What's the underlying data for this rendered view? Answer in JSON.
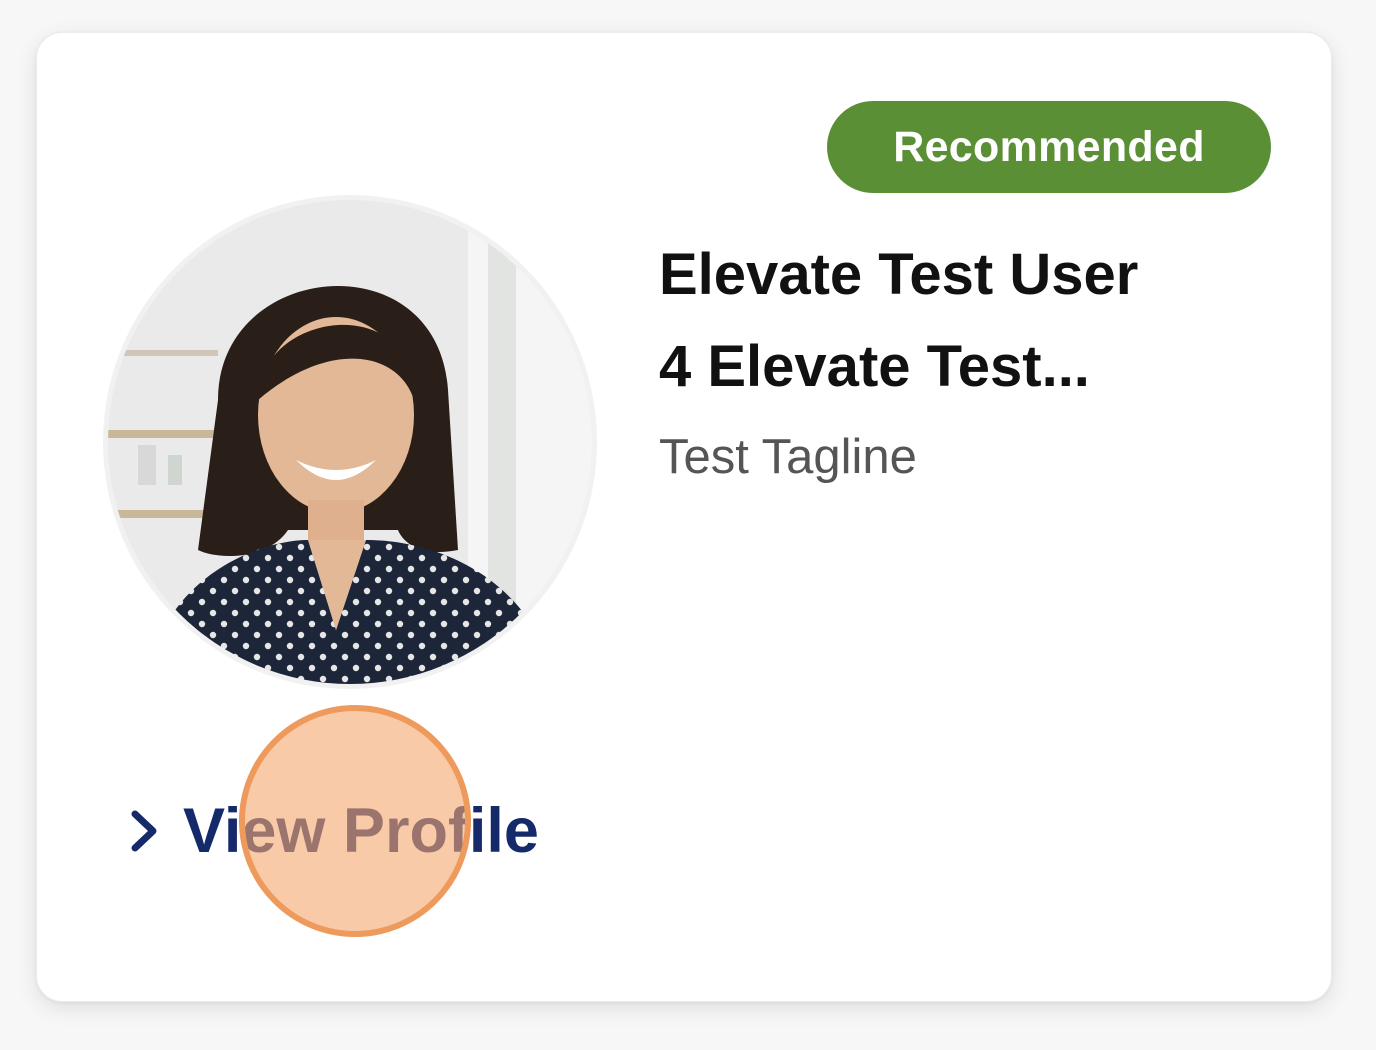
{
  "card": {
    "badge_label": "Recommended",
    "name": "Elevate Test User\n4 Elevate Test...",
    "tagline": "Test Tagline",
    "avatar_icon": "profile-photo",
    "view_profile_icon": "chevron-right-icon",
    "view_profile_label": "View Profile"
  },
  "colors": {
    "badge_bg": "#5a8f35",
    "link_color": "#142a6b",
    "click_marker": "#ee9a5c"
  }
}
